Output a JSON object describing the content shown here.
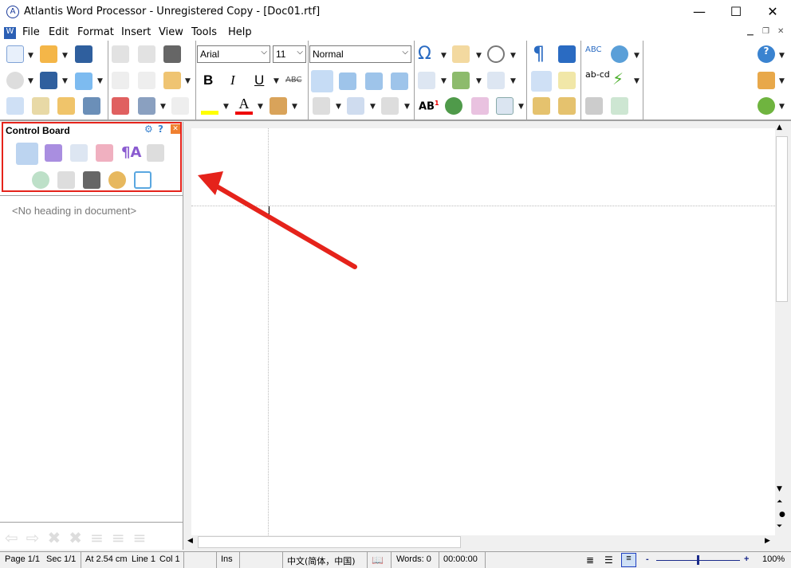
{
  "window": {
    "title": "Atlantis Word Processor - Unregistered Copy - [Doc01.rtf]",
    "minimize": "—",
    "maximize": "☐",
    "close": "✕"
  },
  "menu": [
    "File",
    "Edit",
    "Format",
    "Insert",
    "View",
    "Tools",
    "Help"
  ],
  "toolbar": {
    "font": "Arial",
    "size": "11",
    "style": "Normal",
    "bold": "B",
    "italic": "I",
    "underline": "U",
    "strike": "ABC",
    "ab_label": "AB",
    "abcd": "ab-cd"
  },
  "control_board": {
    "title": "Control Board",
    "no_heading": "<No heading in document>"
  },
  "status": {
    "page": "Page 1/1",
    "sec": "Sec 1/1",
    "at": "At 2.54 cm",
    "line": "Line 1",
    "col": "Col 1",
    "ins": "Ins",
    "lang": "中文(简体，中国)",
    "words": "Words: 0",
    "time": "00:00:00",
    "zoom": "100%",
    "zoom_level": 100
  },
  "colors": {
    "highlight": "#e5231b",
    "accent": "#1e6fd0"
  }
}
